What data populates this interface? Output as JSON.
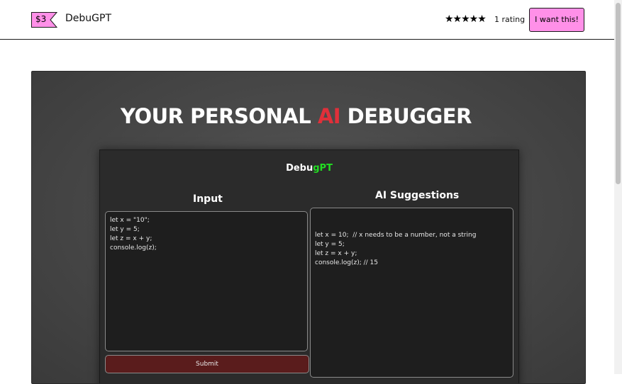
{
  "header": {
    "price": "$3",
    "product_name": "DebuGPT",
    "stars": "★★★★★",
    "rating_label": "1 rating",
    "buy_button": "I want this!"
  },
  "colors": {
    "price_tag": "#ff90e8",
    "buy_button": "#ff90e8",
    "title_accent": "#e0303a",
    "app_title_accent": "#22dd22",
    "submit_button": "#5a1c1c"
  },
  "cover": {
    "title_prefix": "YOUR PERSONAL ",
    "title_accent": "AI",
    "title_suffix": " DEBUGGER",
    "app": {
      "title_prefix": "Debu",
      "title_accent": "gPT",
      "input_heading": "Input",
      "suggestions_heading": "AI Suggestions",
      "input_code": "let x = \"10\";\nlet y = 5;\nlet z = x + y;\nconsole.log(z);",
      "suggestion_code": "let x = 10;  // x needs to be a number, not a string\nlet y = 5;\nlet z = x + y;\nconsole.log(z); // 15",
      "submit_label": "Submit"
    }
  }
}
